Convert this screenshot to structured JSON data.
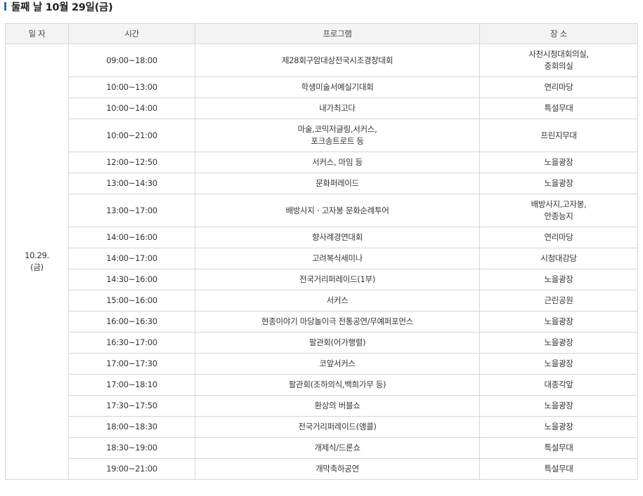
{
  "page": {
    "heading": "둘째 날 10월 29일(금)"
  },
  "table": {
    "headers": {
      "date": "일 자",
      "time": "시간",
      "program": "프로그램",
      "place": "장 소"
    },
    "date": "10.29.\n(금)",
    "rows": [
      {
        "time": "09:00~18:00",
        "program": [
          "제28회구암대상전국시조경창대회"
        ],
        "place": [
          "사천시청대회의실,",
          "중회의실"
        ]
      },
      {
        "time": "10:00~13:00",
        "program": [
          "학생미술서예실기대회"
        ],
        "place": [
          "연리마당"
        ]
      },
      {
        "time": "10:00~14:00",
        "program": [
          "내가최고다"
        ],
        "place": [
          "특설무대"
        ]
      },
      {
        "time": "10:00~21:00",
        "program": [
          "마술,코믹저글링,서커스,",
          "포크송트로트 등"
        ],
        "place": [
          "프린지무대"
        ]
      },
      {
        "time": "12:00~12:50",
        "program": [
          "서커스, 마임 등"
        ],
        "place": [
          "노을광장"
        ]
      },
      {
        "time": "13:00~14:30",
        "program": [
          "문화퍼레이드"
        ],
        "place": [
          "노을광장"
        ]
      },
      {
        "time": "13:00~17:00",
        "program": [
          "배방사지 · 고자봉 문화순례투어"
        ],
        "place": [
          "배방사지,고자봉,",
          "안종능지"
        ]
      },
      {
        "time": "14:00~16:00",
        "program": [
          "향사례경연대회"
        ],
        "place": [
          "연리마당"
        ]
      },
      {
        "time": "14:00~17:00",
        "program": [
          "고려복식세미나"
        ],
        "place": [
          "시청대강당"
        ]
      },
      {
        "time": "14:30~16:00",
        "program": [
          "전국거리퍼레이드(1부)"
        ],
        "place": [
          "노을광장"
        ]
      },
      {
        "time": "15:00~16:00",
        "program": [
          "서커스"
        ],
        "place": [
          "근린공원"
        ]
      },
      {
        "time": "16:00~16:30",
        "program": [
          "현종이야기 마당놀이극 전통공연/무예퍼포먼스"
        ],
        "place": [
          "노을광장"
        ]
      },
      {
        "time": "16:30~17:00",
        "program": [
          "팔관회(어가행렬)"
        ],
        "place": [
          "노을광장"
        ]
      },
      {
        "time": "17:00~17:30",
        "program": [
          "코앞서커스"
        ],
        "place": [
          "노을광장"
        ]
      },
      {
        "time": "17:00~18:10",
        "program": [
          "팔관회(조하의식,백희가무 등)"
        ],
        "place": [
          "대종각앞"
        ]
      },
      {
        "time": "17:30~17:50",
        "program": [
          "환상의 버블쇼"
        ],
        "place": [
          "노을광장"
        ]
      },
      {
        "time": "18:00~18:30",
        "program": [
          "전국거리퍼레이드(앵콜)"
        ],
        "place": [
          "노을광장"
        ]
      },
      {
        "time": "18:30~19:00",
        "program": [
          "개제식/드론쇼"
        ],
        "place": [
          "특설무대"
        ]
      },
      {
        "time": "19:00~21:00",
        "program": [
          "개막축하공연"
        ],
        "place": [
          "특설무대"
        ]
      }
    ]
  }
}
